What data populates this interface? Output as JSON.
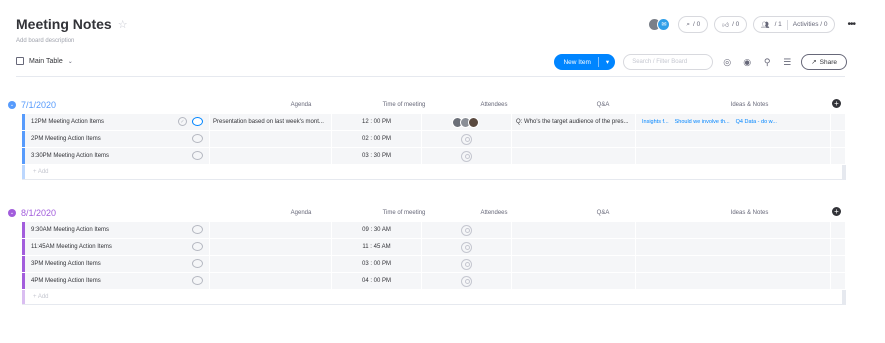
{
  "board": {
    "title": "Meeting Notes",
    "description": "Add board description"
  },
  "header_actions": {
    "search_count": "/ 0",
    "likes_count": "/ 0",
    "members_count": "/ 1",
    "activities": "Activities / 0"
  },
  "toolbar": {
    "view_label": "Main Table",
    "new_item": "New Item",
    "search_placeholder": "Search / Filter Board",
    "share": "Share"
  },
  "columns": [
    "Agenda",
    "Time of meeting",
    "Attendees",
    "Q&A",
    "Ideas & Notes"
  ],
  "groups": [
    {
      "title": "7/1/2020",
      "color": "#579bfc",
      "add_label": "+ Add",
      "rows": [
        {
          "name": "12PM Meeting Action Items",
          "agenda": "Presentation based on last week's mont...",
          "time": "12 : 00 PM",
          "qa": "Q: Who's the target audience of the pres...",
          "ideas": [
            "Insights f...",
            "Should we involve th...",
            "Q4 Data - do w..."
          ]
        },
        {
          "name": "2PM Meeting Action Items",
          "agenda": "",
          "time": "02 : 00 PM",
          "qa": "",
          "ideas": []
        },
        {
          "name": "3:30PM Meeting Action Items",
          "agenda": "",
          "time": "03 : 30 PM",
          "qa": "",
          "ideas": []
        }
      ]
    },
    {
      "title": "8/1/2020",
      "color": "#a25ddc",
      "add_label": "+ Add",
      "rows": [
        {
          "name": "9:30AM Meeting Action Items",
          "time": "09 : 30 AM"
        },
        {
          "name": "11:45AM Meeting Action Items",
          "time": "11 : 45 AM"
        },
        {
          "name": "3PM Meeting Action Items",
          "time": "03 : 00 PM"
        },
        {
          "name": "4PM Meeting Action Items",
          "time": "04 : 00 PM"
        }
      ]
    }
  ]
}
